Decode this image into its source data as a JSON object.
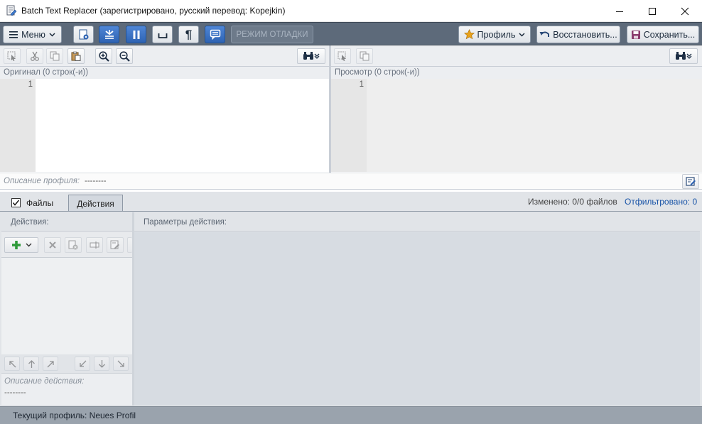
{
  "window": {
    "title": "Batch Text Replacer (зарегистрировано,  русский перевод: Kopejkin)",
    "controls": [
      "minimize-icon",
      "maximize-icon",
      "close-icon"
    ]
  },
  "toolbar": {
    "menu_label": "Меню",
    "debug_mode_label": "РЕЖИМ ОТЛАДКИ",
    "profile_label": "Профиль",
    "restore_label": "Восстановить...",
    "save_label": "Сохранить...",
    "icons": [
      "process-icon",
      "collapse-icon",
      "pause-icon",
      "space-icon",
      "pilcrow-icon",
      "comment-icon"
    ]
  },
  "original_panel": {
    "header": "Оригинал (0 строк(-и))",
    "line_numbers": [
      "1"
    ]
  },
  "preview_panel": {
    "header": "Просмотр (0 строк(-и))",
    "line_numbers": [
      "1"
    ]
  },
  "profile_description": {
    "label": "Описание профиля:",
    "value": "--------"
  },
  "tabs": {
    "files_label": "Файлы",
    "actions_label": "Действия",
    "files_checked": true,
    "active": "Действия"
  },
  "summary": {
    "changed": "Изменено: 0/0 файлов",
    "filtered": "Отфильтровано: 0"
  },
  "actions_panel": {
    "header": "Действия:",
    "description_label": "Описание действия:",
    "description_value": "--------"
  },
  "params_panel": {
    "header": "Параметры действия:"
  },
  "status": {
    "current_profile": "Текущий профиль: Neues Profil"
  },
  "colors": {
    "toolbar_bg": "#5d6a7a",
    "accent_blue": "#2e63b3",
    "link_blue": "#1a55a8",
    "status_bg": "#9aa3ad"
  }
}
